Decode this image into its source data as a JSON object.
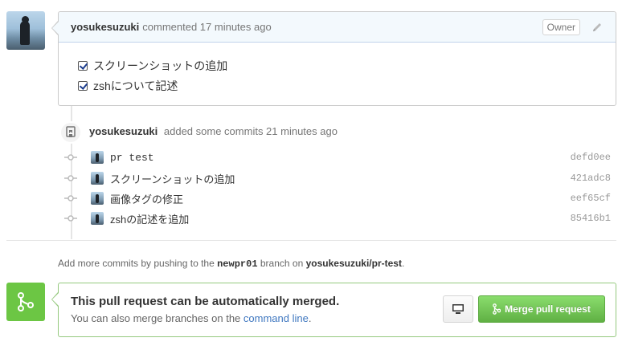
{
  "comment": {
    "author": "yosukesuzuki",
    "action": "commented 17 minutes ago",
    "owner_badge": "Owner",
    "tasks": [
      {
        "label": "スクリーンショットの追加",
        "checked": true
      },
      {
        "label": "zshについて記述",
        "checked": true
      }
    ]
  },
  "commit_event": {
    "author": "yosukesuzuki",
    "action": "added some commits 21 minutes ago",
    "commits": [
      {
        "message": "pr test",
        "sha": "defd0ee",
        "mono": true
      },
      {
        "message": "スクリーンショットの追加",
        "sha": "421adc8",
        "mono": false
      },
      {
        "message": "画像タグの修正",
        "sha": "eef65cf",
        "mono": false
      },
      {
        "message": "zshの記述を追加",
        "sha": "85416b1",
        "mono": false
      }
    ]
  },
  "push_note": {
    "prefix": "Add more commits by pushing to the",
    "branch": "newpr01",
    "middle": "branch on",
    "repo": "yosukesuzuki/pr-test",
    "suffix": "."
  },
  "merge": {
    "title": "This pull request can be automatically merged.",
    "sub_prefix": "You can also merge branches on the",
    "link": "command line",
    "sub_suffix": ".",
    "button": "Merge pull request",
    "colors": {
      "badge": "#6cc644",
      "button": "#60b044",
      "link": "#4078c0"
    }
  },
  "icons": [
    "pencil-icon",
    "git-commit-icon",
    "git-merge-icon",
    "desktop-icon"
  ]
}
